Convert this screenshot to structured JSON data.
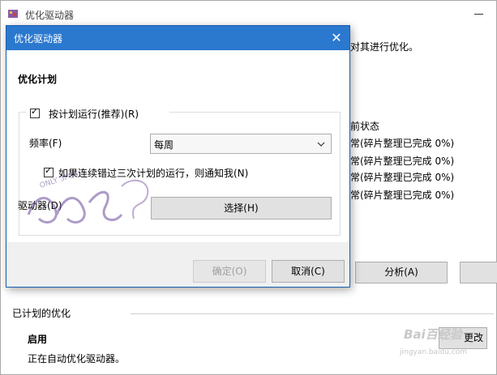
{
  "background_window": {
    "title": "优化驱动器",
    "description_fragment": "对其进行优化。",
    "column_header": "前状态",
    "status_rows": [
      "常(碎片整理已完成 0%)",
      "常(碎片整理已完成 0%)",
      "常(碎片整理已完成 0%)",
      "常(碎片整理已完成 0%)"
    ],
    "analyze_label": "分析(A)",
    "scheduled_title": "已计划的优化",
    "enabled_label": "启用",
    "running_text": "正在自动优化驱动器。",
    "change_label": "更改"
  },
  "dialog": {
    "title": "优化驱动器",
    "heading": "优化计划",
    "run_on_schedule": {
      "label": "按计划运行(推荐)(R)",
      "checked": true
    },
    "frequency": {
      "label": "频率(F)",
      "selected": "每周"
    },
    "notify_missed": {
      "label": "如果连续错过三次计划的运行，则通知我(N)",
      "checked": true
    },
    "drives": {
      "label": "驱动器(D)",
      "button_label": "选择(H)"
    },
    "ok_label": "确定(O)",
    "cancel_label": "取消(C)"
  },
  "watermark": {
    "logo_text": "ONLY 3PCS",
    "baidu_text": "Bai百经验",
    "url": "jingyan.baidu.com"
  },
  "colors": {
    "titlebar": "#2b78cf",
    "dialog_bg": "#f0f0f0",
    "button_bg": "#e1e1e1"
  }
}
